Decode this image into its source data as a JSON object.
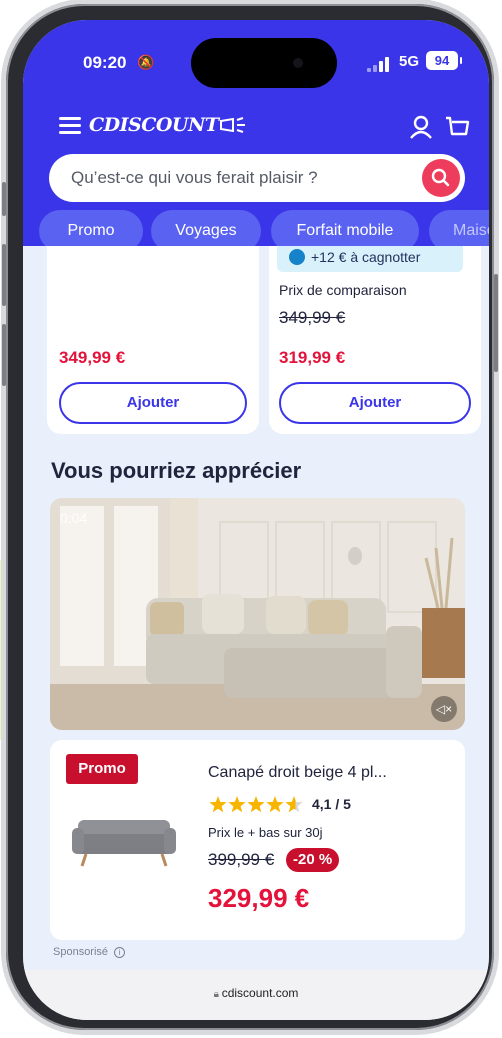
{
  "status": {
    "time": "09:20",
    "network": "5G",
    "battery": "94"
  },
  "header": {
    "logo": "CDISCOUNT"
  },
  "search": {
    "placeholder": "Qu’est-ce qui vous ferait plaisir ?"
  },
  "chips": [
    "Promo",
    "Voyages",
    "Forfait mobile",
    "Maison"
  ],
  "product_left": {
    "price": "349,99 €",
    "button": "Ajouter"
  },
  "product_right": {
    "cagnotte": "+12 € à cagnotter",
    "comparison_label": "Prix de comparaison",
    "old_price": "349,99 €",
    "price": "319,99 €",
    "button": "Ajouter"
  },
  "section_title": "Vous pourriez apprécier",
  "video": {
    "time": "0:04"
  },
  "sponsored_product": {
    "badge": "Promo",
    "title": "Canapé droit beige 4 pl...",
    "rating": "4,1 / 5",
    "rating_value": 4.1,
    "price_label": "Prix le + bas sur 30j",
    "old_price": "399,99 €",
    "discount": "-20 %",
    "price": "329,99 €"
  },
  "sponsored_label": "Sponsorisé",
  "browser": {
    "url": "cdiscount.com"
  },
  "colors": {
    "brand_blue": "#3a35e8",
    "price_red": "#e3133b",
    "promo_red": "#c8102e",
    "search_btn": "#ee3d5c"
  }
}
